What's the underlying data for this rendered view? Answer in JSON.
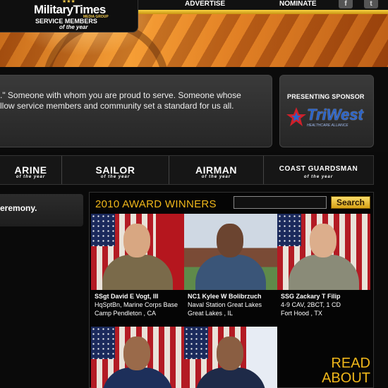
{
  "header": {
    "logo_main": "MilitaryTimes",
    "logo_sub": "MEDIA GROUP",
    "logo_line1": "SERVICE MEMBERS",
    "logo_line2": "of the year",
    "nav": [
      {
        "label": "ADVERTISE"
      },
      {
        "label": "NOMINATE"
      }
    ],
    "social": [
      {
        "icon": "facebook-icon",
        "glyph": "f"
      },
      {
        "icon": "twitter-icon",
        "glyph": "t"
      }
    ]
  },
  "mission": {
    "line1": ".\" Someone with whom you are proud to serve. Someone whose",
    "line2": "llow service members and community set a standard for us all."
  },
  "sponsor": {
    "label": "PRESENTING SPONSOR",
    "name": "TriWest",
    "tagline": "HEALTHCARE ALLIANCE",
    "colors": {
      "blue": "#2b63c8",
      "red": "#d0202a"
    }
  },
  "branches": [
    {
      "label": "ARINE",
      "sub": "of the year"
    },
    {
      "label": "SAILOR",
      "sub": "of the year"
    },
    {
      "label": "AIRMAN",
      "sub": "of the year"
    },
    {
      "label": "COAST GUARDSMAN",
      "sub": "of the year"
    }
  ],
  "news": {
    "text": "eremony."
  },
  "awards": {
    "title": "2010 AWARD WINNERS",
    "search_value": "",
    "search_button": "Search",
    "read_about_line1": "READ",
    "read_about_line2": "ABOUT",
    "winners": [
      {
        "name": "SSgt David E Vogt, III",
        "unit": "HqSptBn, Marine Corps Base",
        "location": "Camp Pendleton , CA",
        "uniform": "#7a6a4a",
        "skin": "#d8a782",
        "background": "flag-marine"
      },
      {
        "name": "NC1 Kylee W Bolibrzuch",
        "unit": "Naval Station Great Lakes",
        "location": "Great Lakes , IL",
        "uniform": "#3a5578",
        "skin": "#6b4430",
        "background": "outdoor"
      },
      {
        "name": "SSG Zackary T Filip",
        "unit": "4-9 CAV, 2BCT, 1 CD",
        "location": "Fort Hood , TX",
        "uniform": "#8a8b78",
        "skin": "#dcae8c",
        "background": "flag"
      },
      {
        "name": "",
        "unit": "",
        "location": "",
        "uniform": "#1d2f5a",
        "skin": "#9a6a4a",
        "background": "flag"
      },
      {
        "name": "",
        "unit": "",
        "location": "",
        "uniform": "#1e2a48",
        "skin": "#8a5e42",
        "background": "flag-coastguard"
      }
    ]
  }
}
